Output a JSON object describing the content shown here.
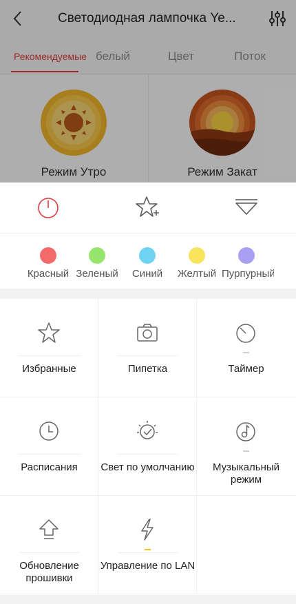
{
  "header": {
    "title": "Светодиодная лампочка Ye..."
  },
  "tabs": [
    {
      "label": "Рекомендуемые"
    },
    {
      "label": "белый"
    },
    {
      "label": "Цвет"
    },
    {
      "label": "Поток"
    }
  ],
  "modes": [
    {
      "label": "Режим Утро"
    },
    {
      "label": "Режим Закат"
    }
  ],
  "actions": {
    "power_icon": "power-icon",
    "favorite_add_icon": "star-plus-icon",
    "collapse_icon": "collapse-icon"
  },
  "colors": [
    {
      "label": "Красный",
      "hex": "#f46a6a"
    },
    {
      "label": "Зеленый",
      "hex": "#97e66b"
    },
    {
      "label": "Синий",
      "hex": "#6fd4f4"
    },
    {
      "label": "Желтый",
      "hex": "#f9e45e"
    },
    {
      "label": "Пурпурный",
      "hex": "#a9a0f3"
    }
  ],
  "features": [
    {
      "label": "Избранные",
      "icon": "star-icon"
    },
    {
      "label": "Пипетка",
      "icon": "camera-icon"
    },
    {
      "label": "Таймер",
      "icon": "timer-icon"
    },
    {
      "label": "Расписания",
      "icon": "clock-icon"
    },
    {
      "label": "Свет по умолчанию",
      "icon": "default-light-icon"
    },
    {
      "label": "Музыкальный режим",
      "icon": "music-icon"
    },
    {
      "label": "Обновление прошивки",
      "icon": "upgrade-icon"
    },
    {
      "label": "Управление по LAN",
      "icon": "lightning-icon"
    }
  ],
  "accent_color": "#e23b3b"
}
